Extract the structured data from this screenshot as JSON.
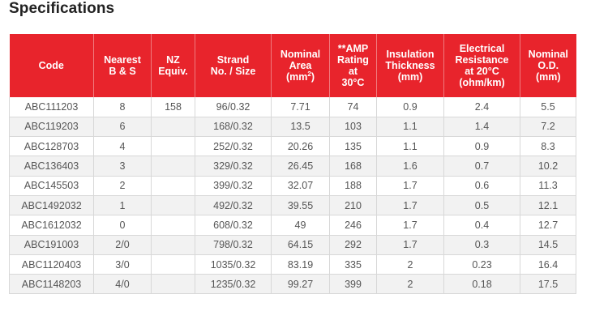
{
  "title": "Specifications",
  "columns": [
    {
      "key": "code",
      "label": "Code"
    },
    {
      "key": "nearest",
      "label": "Nearest B & S"
    },
    {
      "key": "nz",
      "label": "NZ Equiv."
    },
    {
      "key": "strand",
      "label": "Strand No. / Size"
    },
    {
      "key": "area",
      "label": "Nominal Area (mm²)"
    },
    {
      "key": "amp",
      "label": "**AMP Rating at 30°C"
    },
    {
      "key": "insulation",
      "label": "Insulation Thickness (mm)"
    },
    {
      "key": "resistance",
      "label": "Electrical Resistance at 20°C (ohm/km)"
    },
    {
      "key": "od",
      "label": "Nominal O.D. (mm)"
    }
  ],
  "header_lines": {
    "code": [
      "Code"
    ],
    "nearest": [
      "Nearest",
      "B & S"
    ],
    "nz": [
      "NZ",
      "Equiv."
    ],
    "strand": [
      "Strand",
      "No. / Size"
    ],
    "area": [
      "Nominal",
      "Area",
      "(mm²)"
    ],
    "amp": [
      "**AMP",
      "Rating",
      "at",
      "30°C"
    ],
    "insulation": [
      "Insulation",
      "Thickness",
      "(mm)"
    ],
    "resistance": [
      "Electrical",
      "Resistance",
      "at 20°C",
      "(ohm/km)"
    ],
    "od": [
      "Nominal",
      "O.D.",
      "(mm)"
    ]
  },
  "rows": [
    [
      "ABC111203",
      "8",
      "158",
      "96/0.32",
      "7.71",
      "74",
      "0.9",
      "2.4",
      "5.5"
    ],
    [
      "ABC119203",
      "6",
      "",
      "168/0.32",
      "13.5",
      "103",
      "1.1",
      "1.4",
      "7.2"
    ],
    [
      "ABC128703",
      "4",
      "",
      "252/0.32",
      "20.26",
      "135",
      "1.1",
      "0.9",
      "8.3"
    ],
    [
      "ABC136403",
      "3",
      "",
      "329/0.32",
      "26.45",
      "168",
      "1.6",
      "0.7",
      "10.2"
    ],
    [
      "ABC145503",
      "2",
      "",
      "399/0.32",
      "32.07",
      "188",
      "1.7",
      "0.6",
      "11.3"
    ],
    [
      "ABC1492032",
      "1",
      "",
      "492/0.32",
      "39.55",
      "210",
      "1.7",
      "0.5",
      "12.1"
    ],
    [
      "ABC1612032",
      "0",
      "",
      "608/0.32",
      "49",
      "246",
      "1.7",
      "0.4",
      "12.7"
    ],
    [
      "ABC191003",
      "2/0",
      "",
      "798/0.32",
      "64.15",
      "292",
      "1.7",
      "0.3",
      "14.5"
    ],
    [
      "ABC1120403",
      "3/0",
      "",
      "1035/0.32",
      "83.19",
      "335",
      "2",
      "0.23",
      "16.4"
    ],
    [
      "ABC1148203",
      "4/0",
      "",
      "1235/0.32",
      "99.27",
      "399",
      "2",
      "0.18",
      "17.5"
    ]
  ],
  "colors": {
    "header_bg": "#e8242c",
    "header_text": "#ffffff",
    "row_alt_bg": "#f2f2f2",
    "border": "#d8d8d8"
  }
}
